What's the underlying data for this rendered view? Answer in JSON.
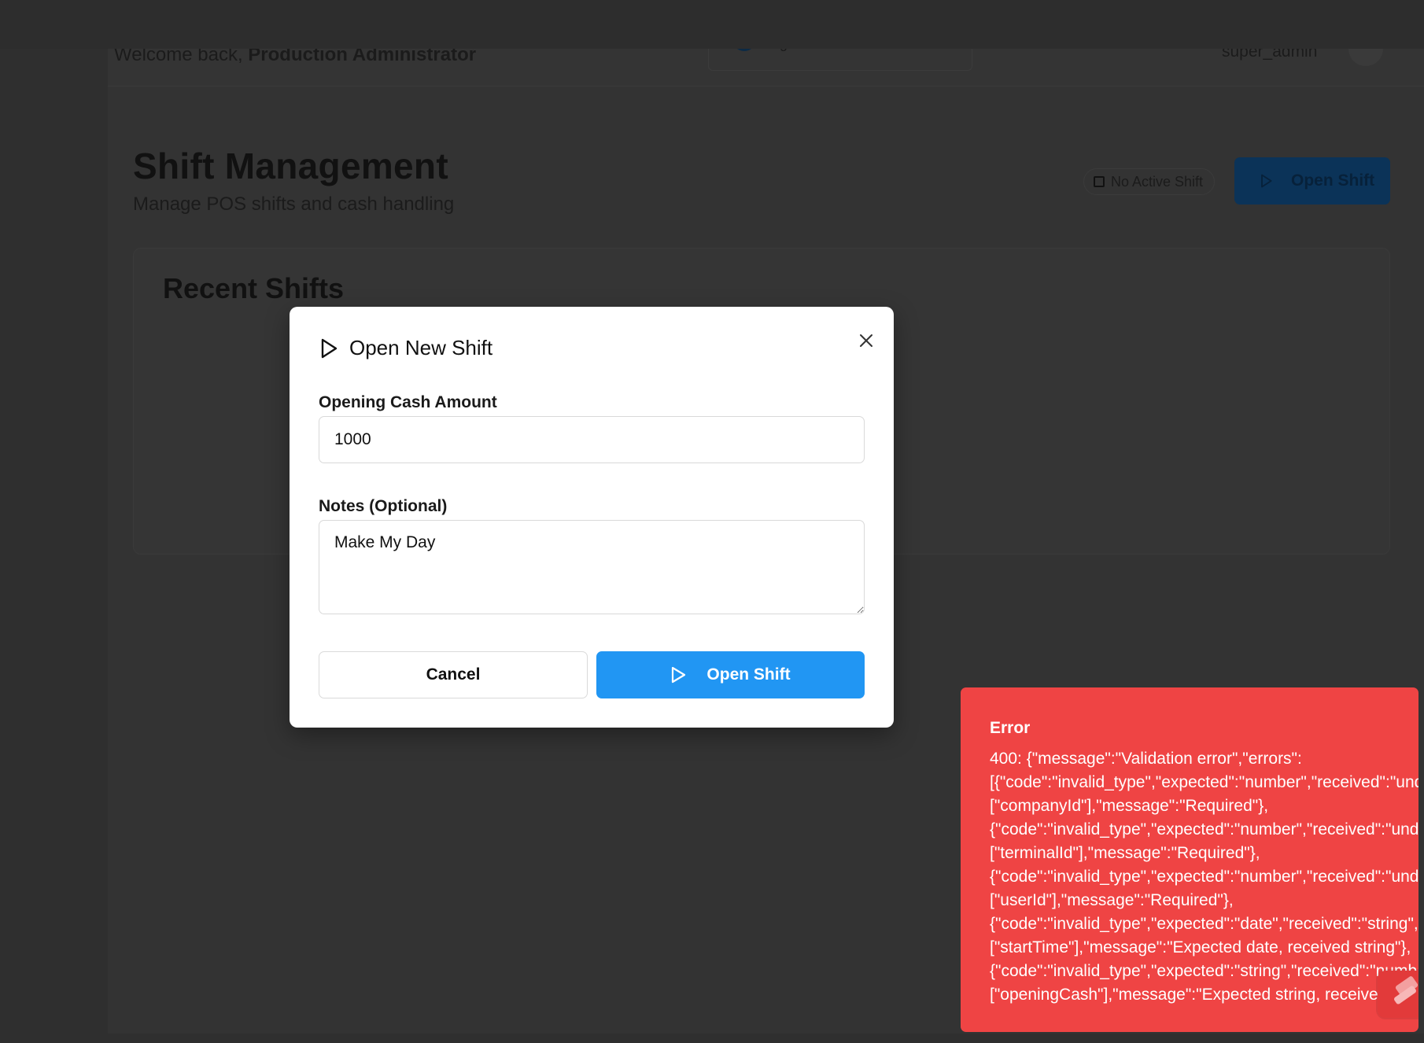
{
  "header": {
    "welcome_prefix": "Welcome back,",
    "welcome_user": "Production Administrator",
    "company": "general",
    "role": "super_admin"
  },
  "page": {
    "title": "Shift Management",
    "subtitle": "Manage POS shifts and cash handling",
    "shift_status": "No Active Shift",
    "open_shift_label": "Open Shift",
    "recent_title": "Recent Shifts"
  },
  "modal": {
    "title": "Open New Shift",
    "opening_cash_label": "Opening Cash Amount",
    "opening_cash_value": "1000",
    "notes_label": "Notes (Optional)",
    "notes_value": "Make My Day",
    "cancel_label": "Cancel",
    "submit_label": "Open Shift"
  },
  "toast": {
    "title": "Error",
    "lines": [
      "400: {\"message\":\"Validation error\",\"errors\":",
      "[{\"code\":\"invalid_type\",\"expected\":\"number\",\"received\":\"und",
      "[\"companyId\"],\"message\":\"Required\"},",
      "{\"code\":\"invalid_type\",\"expected\":\"number\",\"received\":\"und",
      "[\"terminalId\"],\"message\":\"Required\"},",
      "{\"code\":\"invalid_type\",\"expected\":\"number\",\"received\":\"und",
      "[\"userId\"],\"message\":\"Required\"},",
      "{\"code\":\"invalid_type\",\"expected\":\"date\",\"received\":\"string\",",
      "[\"startTime\"],\"message\":\"Expected date, received string\"},",
      "{\"code\":\"invalid_type\",\"expected\":\"string\",\"received\":\"numb",
      "[\"openingCash\"],\"message\":\"Expected string, received num"
    ]
  },
  "colors": {
    "primary": "#2196f3",
    "error": "#ef4444",
    "overlay": "#333333"
  },
  "icons": [
    "play-icon",
    "close-icon",
    "square-icon",
    "toast-app-icon"
  ]
}
